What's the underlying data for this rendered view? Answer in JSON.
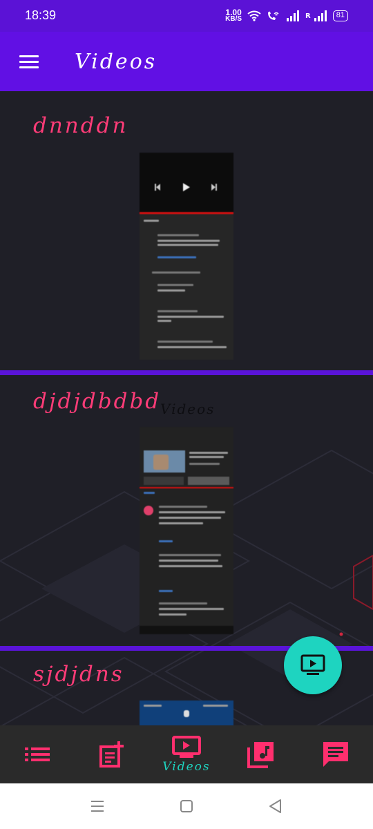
{
  "status_bar": {
    "time": "18:39",
    "net_speed_value": "1.00",
    "net_speed_unit": "KB/S",
    "roaming_label": "R",
    "battery": "81"
  },
  "app_bar": {
    "title": "Videos",
    "menu_icon": "hamburger-menu-icon"
  },
  "videos": [
    {
      "title": "dnnddn"
    },
    {
      "title": "djdjdbdbd"
    },
    {
      "title": "sjdjdns"
    }
  ],
  "ghost_title": "Videos",
  "fab": {
    "icon": "tv-play-icon"
  },
  "bottom_nav": {
    "items": [
      {
        "icon": "list-icon",
        "label": ""
      },
      {
        "icon": "playlist-add-icon",
        "label": ""
      },
      {
        "icon": "tv-play-icon",
        "label": "Videos",
        "active": true
      },
      {
        "icon": "music-library-icon",
        "label": ""
      },
      {
        "icon": "message-icon",
        "label": ""
      }
    ]
  },
  "colors": {
    "primary": "#6110e4",
    "accent": "#ff3c78",
    "teal": "#1ed4c0",
    "background": "#1f1f27"
  }
}
